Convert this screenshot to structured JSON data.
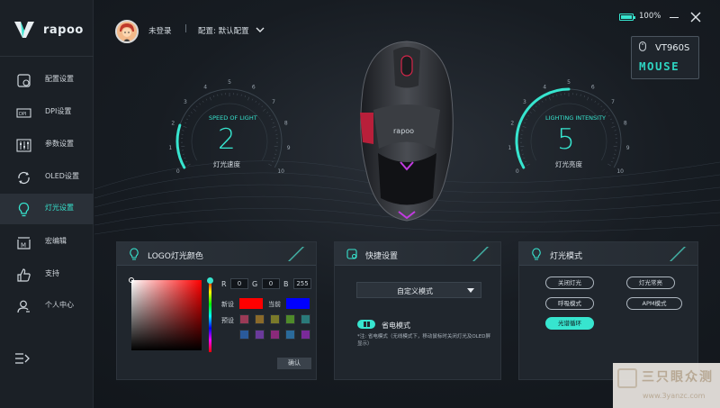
{
  "brand": {
    "logo_text": "rapoo",
    "accent": "#37e5cf"
  },
  "header": {
    "login_text": "未登录",
    "divider": "|",
    "config_label": "配置: 默认配置",
    "battery_pct": "100%",
    "battery_level": 1.0
  },
  "sidebar": {
    "items": [
      {
        "label": "配置设置",
        "icon": "config-icon"
      },
      {
        "label": "DPI设置",
        "icon": "dpi-icon"
      },
      {
        "label": "参数设置",
        "icon": "sliders-icon"
      },
      {
        "label": "OLED设置",
        "icon": "refresh-icon"
      },
      {
        "label": "灯光设置",
        "icon": "bulb-icon",
        "active": true
      },
      {
        "label": "宏编辑",
        "icon": "macro-icon"
      },
      {
        "label": "支持",
        "icon": "thumbs-up-icon"
      },
      {
        "label": "个人中心",
        "icon": "user-icon"
      }
    ]
  },
  "model": {
    "name": "VT960S",
    "type": "MOUSE"
  },
  "gauges": {
    "left": {
      "title": "SPEED OF LIGHT",
      "value": "2",
      "label": "灯光速度",
      "min": 0,
      "max": 10,
      "ticks": [
        "0",
        "1",
        "2",
        "3",
        "4",
        "5",
        "6",
        "7",
        "8",
        "9",
        "10"
      ]
    },
    "right": {
      "title": "LIGHTING INTENSITY",
      "value": "5",
      "label": "灯光亮度",
      "min": 0,
      "max": 10,
      "ticks": [
        "0",
        "1",
        "2",
        "3",
        "4",
        "5",
        "6",
        "7",
        "8",
        "9",
        "10"
      ]
    }
  },
  "logo_panel": {
    "title": "LOGO灯光颜色",
    "r_label": "R",
    "r_value": "0",
    "g_label": "G",
    "g_value": "0",
    "b_label": "B",
    "b_value": "255",
    "new_label": "新设",
    "current_label": "当前",
    "new_color": "#ff0000",
    "current_color": "#0000ff",
    "preset_label": "预设",
    "presets": [
      "#9a3a56",
      "#8a6a2a",
      "#7a7a2a",
      "#4f8a2a",
      "#2a7a7a",
      "#2a5a9a",
      "#6a3a9a",
      "#8a2a7a",
      "#2a6a9a",
      "#7a2a9a"
    ],
    "confirm_label": "确认"
  },
  "quick_panel": {
    "title": "快捷设置",
    "select_value": "自定义模式",
    "toggle_label": "省电模式",
    "note": "*注: 省电模式（无线模式下，移动鼠标时关闭灯光及OLED屏显示）"
  },
  "mode_panel": {
    "title": "灯光模式",
    "modes": [
      "关闭灯光",
      "灯光常亮",
      "呼吸模式",
      "APM模式",
      "光谱循环"
    ],
    "active_mode": "光谱循环"
  },
  "watermark": {
    "title": "三只眼众测",
    "url": "www.3yanzc.com"
  }
}
